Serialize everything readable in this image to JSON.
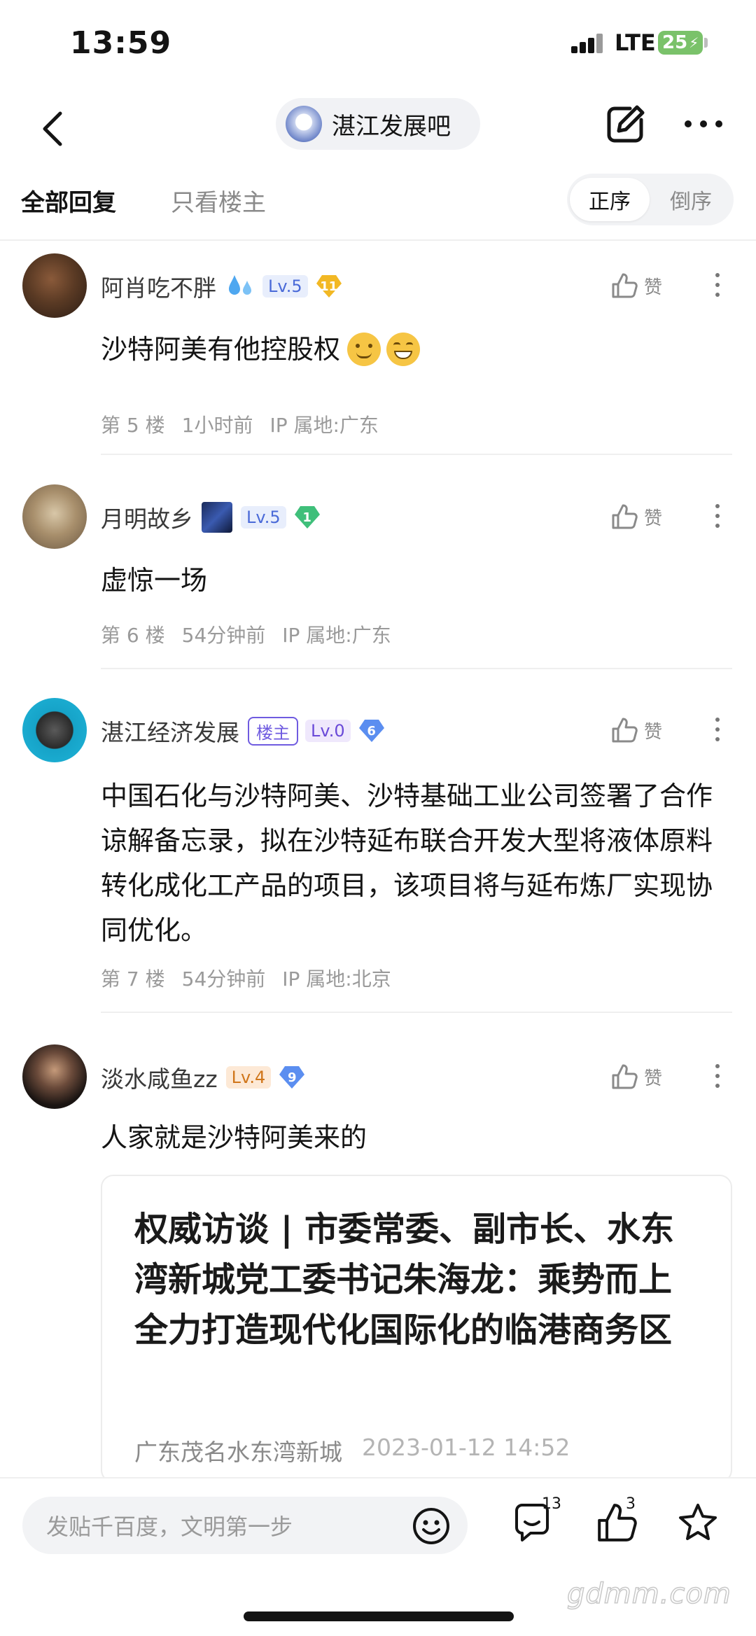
{
  "status_bar": {
    "time": "13:59",
    "network": "LTE",
    "battery": "25"
  },
  "nav": {
    "forum_name": "湛江发展吧",
    "icons": [
      "back-chevron-icon",
      "share-edit-icon",
      "more-dots-icon"
    ]
  },
  "tabs": {
    "all_replies": "全部回复",
    "only_op": "只看楼主",
    "order_asc": "正序",
    "order_desc": "倒序"
  },
  "like_label": "赞",
  "posts": [
    {
      "username": "阿肖吃不胖",
      "level": "Lv.5",
      "gem_level": "11",
      "content": "沙特阿美有他控股权",
      "floor": "第 5 楼",
      "time": "1小时前",
      "ip": "IP 属地:广东"
    },
    {
      "username": "月明故乡",
      "level": "Lv.5",
      "gem_level": "1",
      "content": "虚惊一场",
      "floor": "第 6 楼",
      "time": "54分钟前",
      "ip": "IP 属地:广东"
    },
    {
      "username": "湛江经济发展",
      "op_badge": "楼主",
      "level": "Lv.0",
      "gem_level": "6",
      "content": "中国石化与沙特阿美、沙特基础工业公司签署了合作谅解备忘录，拟在沙特延布联合开发大型将液体原料转化成化工产品的项目，该项目将与延布炼厂实现协同优化。",
      "floor": "第 7 楼",
      "time": "54分钟前",
      "ip": "IP 属地:北京"
    },
    {
      "username": "淡水咸鱼zz",
      "level": "Lv.4",
      "gem_level": "9",
      "content": "人家就是沙特阿美来的",
      "card": {
        "title": "权威访谈 | 市委常委、副市长、水东湾新城党工委书记朱海龙：乘势而上全力打造现代化国际化的临港商务区",
        "source": "广东茂名水东湾新城",
        "date": "2023-01-12 14:52"
      }
    }
  ],
  "bottom_bar": {
    "input_placeholder": "发贴千百度，文明第一步",
    "comment_count": "13",
    "like_count": "3"
  },
  "watermark": "gdmm.com",
  "colors": {
    "accent_purple": "#6f5be0",
    "level_blue": "#4a6ad8",
    "gem_gold": "#f2b824",
    "gem_green": "#3fbf7a",
    "gem_blue": "#5b8ef0",
    "battery_green": "#7ac26a"
  }
}
